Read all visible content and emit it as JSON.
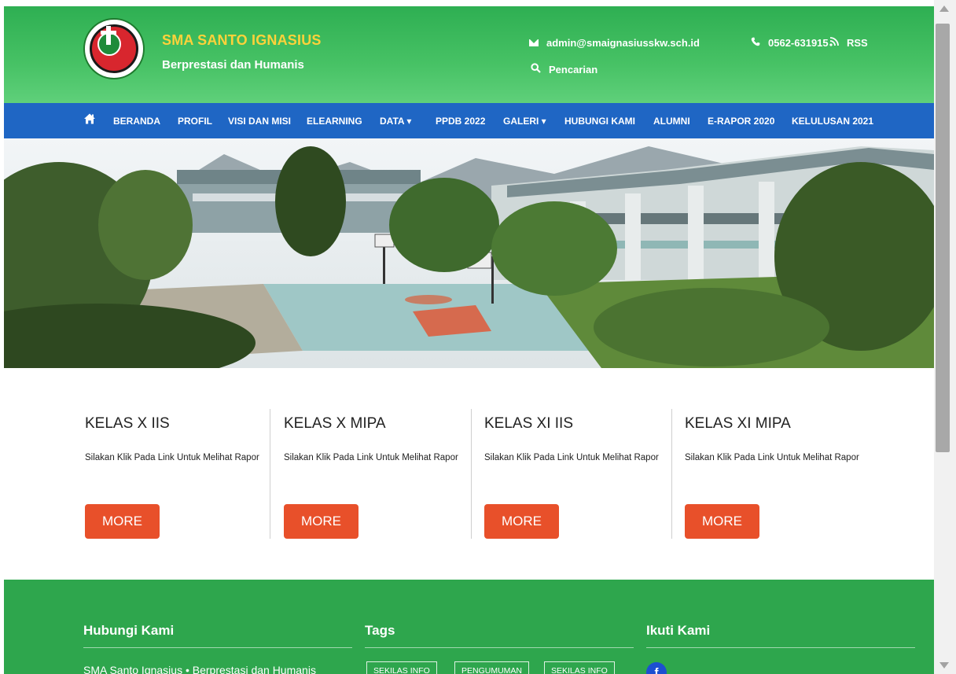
{
  "header": {
    "site_title": "SMA SANTO IGNASIUS",
    "tagline": "Berprestasi dan Humanis",
    "email": "admin@smaignasiusskw.sch.id",
    "phone": "0562-631915",
    "rss": "RSS",
    "search": "Pencarian",
    "colors": {
      "green": "#2eaf52",
      "title_yellow": "#ffd23a"
    }
  },
  "nav": {
    "items": [
      {
        "label": "BERANDA"
      },
      {
        "label": "PROFIL"
      },
      {
        "label": "VISI DAN MISI"
      },
      {
        "label": "ELEARNING"
      },
      {
        "label": "DATA  ▾"
      },
      {
        "label": "PPDB 2022"
      },
      {
        "label": "GALERI ▾"
      },
      {
        "label": "HUBUNGI KAMI"
      },
      {
        "label": "ALUMNI"
      },
      {
        "label": "E-RAPOR 2020"
      },
      {
        "label": "KELULUSAN 2021"
      }
    ],
    "color": "#1f66c4"
  },
  "cards": [
    {
      "title": "KELAS X IIS",
      "text": "Silakan Klik Pada Link Untuk Melihat Rapor",
      "button": "MORE"
    },
    {
      "title": "KELAS X MIPA",
      "text": "Silakan Klik Pada Link Untuk Melihat Rapor",
      "button": "MORE"
    },
    {
      "title": "KELAS XI IIS",
      "text": "Silakan Klik Pada Link Untuk Melihat Rapor",
      "button": "MORE"
    },
    {
      "title": "KELAS XI MIPA",
      "text": "Silakan Klik Pada Link Untuk Melihat Rapor",
      "button": "MORE"
    }
  ],
  "footer": {
    "contact_heading": "Hubungi Kami",
    "tags_heading": "Tags",
    "follow_heading": "Ikuti Kami",
    "contact_text": "SMA Santo Ignasius  •  Berprestasi dan Humanis",
    "tags": [
      "SEKILAS INFO",
      "PENGUMUMAN",
      "SEKILAS INFO"
    ],
    "facebook": "f",
    "color": "#2ea64d"
  }
}
